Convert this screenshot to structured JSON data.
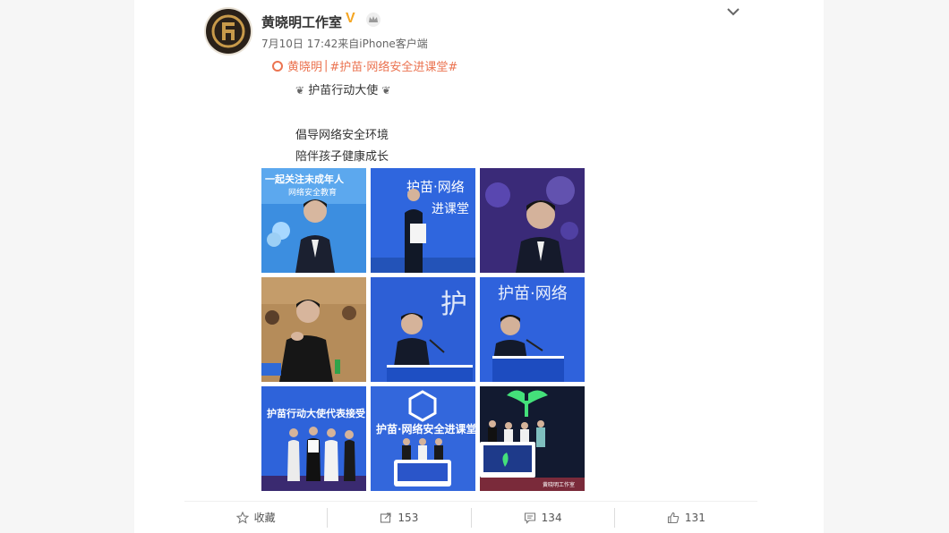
{
  "post": {
    "author": "黄晓明工作室",
    "verified_badge": "V",
    "meta": "7月10日 17:42来自iPhone客户端",
    "tag_author": "黄晓明",
    "tag_sep": " |",
    "topic": "#护苗·网络安全进课堂#",
    "line1_text": "护苗行动大使",
    "line2": "倡导网络安全环境",
    "line3": "陪伴孩子健康成长"
  },
  "photos": {
    "p1_top": "一起关注未成年人",
    "p1_sub": "网络安全教育",
    "p2_title": "护苗·网络",
    "p2_sub": "进课堂",
    "p5_title": "护",
    "p6_title": "护苗·网络",
    "p7_title": "护苗行动大使代表接受",
    "p8_title": "护苗·网络安全进课堂",
    "p9_caption": "黄晓明工作室"
  },
  "footer": {
    "favorite_label": "收藏",
    "repost_count": "153",
    "comment_count": "134",
    "like_count": "131"
  },
  "colors": {
    "accent": "#eb7350",
    "verified": "#f5a623",
    "stage_blue": "#2f5bd8"
  },
  "icons": [
    "crown-icon",
    "chevron-down-icon",
    "location-icon",
    "sprout-icon",
    "star-icon",
    "repost-icon",
    "comment-icon",
    "like-icon"
  ]
}
